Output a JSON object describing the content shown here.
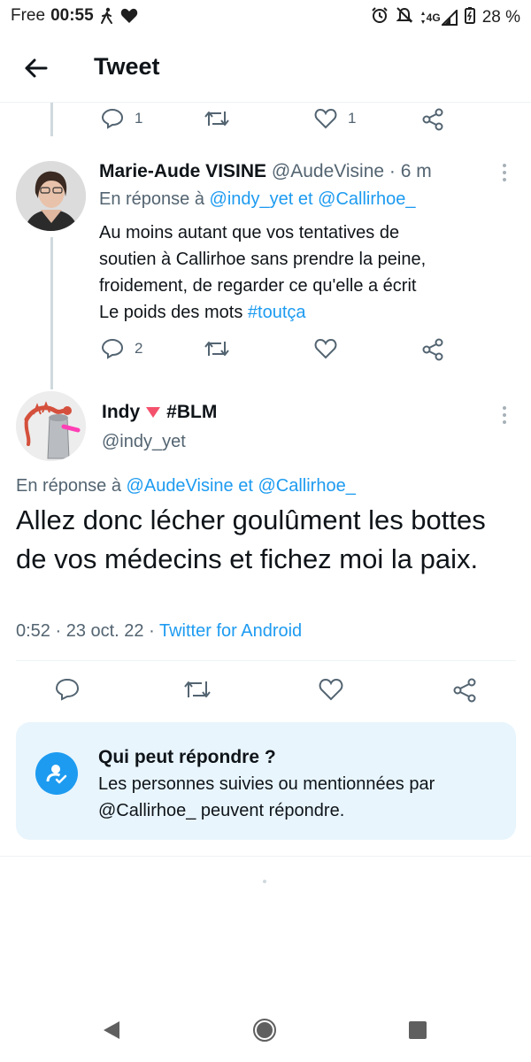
{
  "status_bar": {
    "carrier": "Free",
    "time": "00:55",
    "network": "4G",
    "battery": "28 %"
  },
  "header": {
    "title": "Tweet",
    "back_icon": "arrow-left-icon"
  },
  "parent_actions": {
    "replies": "1",
    "likes": "1"
  },
  "reply_tweet": {
    "author_name": "Marie-Aude VISINE",
    "author_handle": "@AudeVisine",
    "separator": "·",
    "time_ago": "6 m",
    "reply_prefix": "En réponse à",
    "reply_mention_1": "@indy_yet",
    "reply_and": "et",
    "reply_mention_2": "@Callirhoe_",
    "text_lines": [
      "Au moins autant que vos tentatives de",
      "soutien à Callirhoe sans prendre la peine,",
      "froidement, de regarder ce qu'elle a écrit",
      "Le poids des mots"
    ],
    "hashtag": "#toutça",
    "replies": "2"
  },
  "main_tweet": {
    "author_name": "Indy",
    "author_tag": "#BLM",
    "author_handle": "@indy_yet",
    "reply_prefix": "En réponse à",
    "reply_mention_1": "@AudeVisine",
    "reply_and": "et",
    "reply_mention_2": "@Callirhoe_",
    "text": "Allez donc lécher goulûment les bottes de vos médecins et fichez moi la paix.",
    "timestamp": "0:52 · 23 oct. 22",
    "meta_separator": "·",
    "source": "Twitter for Android"
  },
  "who_can_reply": {
    "title": "Qui peut répondre ?",
    "description": "Les personnes suivies ou mentionnées par @Callirhoe_ peuvent répondre."
  },
  "colors": {
    "accent": "#1d9bf0",
    "secondary_text": "#536471",
    "primary_text": "#0f1419",
    "card_bg": "#e8f5fd",
    "heart_badge": "#f4516c"
  }
}
